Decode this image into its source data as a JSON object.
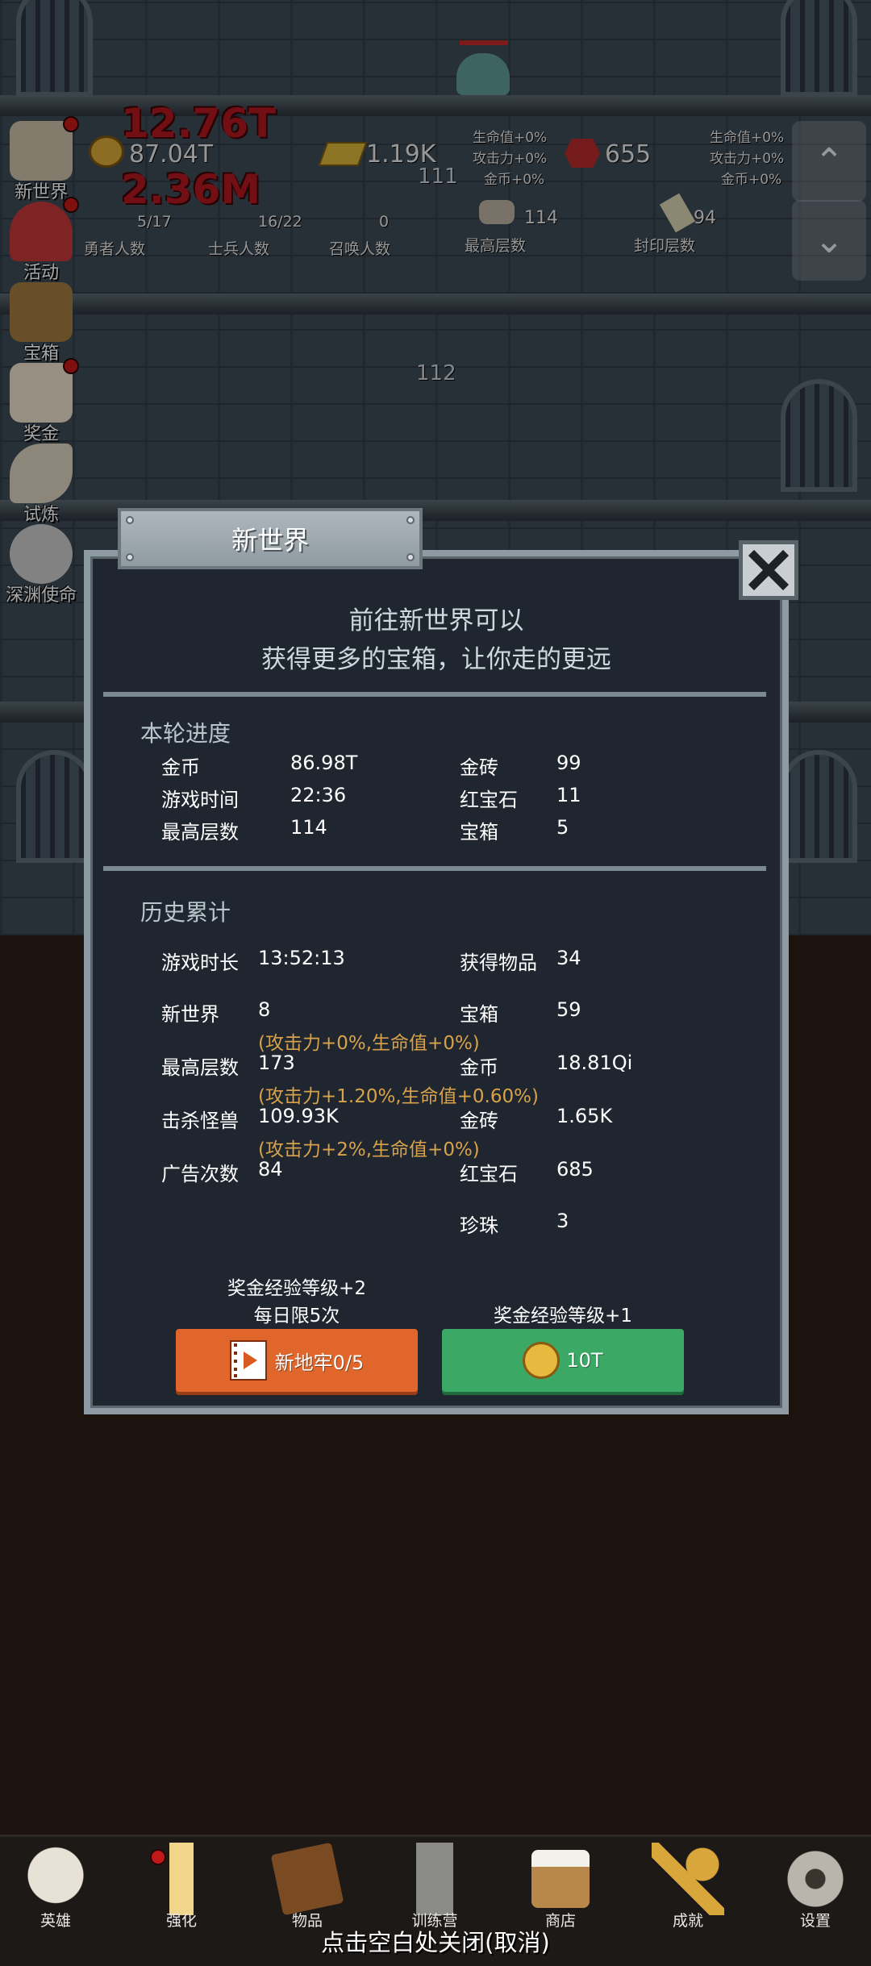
{
  "hud": {
    "gold_value": "87.04T",
    "gold_bar_value": "1.19K",
    "ruby_value": "655",
    "stats_left": [
      "生命值+0%",
      "攻击力+0%",
      "金币+0%"
    ],
    "stats_right": [
      "生命值+0%",
      "攻击力+0%",
      "金币+0%"
    ],
    "hero_count": "5/17",
    "hero_label": "勇者人数",
    "soldier_count": "16/22",
    "soldier_label": "士兵人数",
    "summon_count": "0",
    "summon_label": "召唤人数",
    "max_floor_value": "114",
    "max_floor_label": "最高层数",
    "seal_floor_value": "94",
    "seal_floor_label": "封印层数",
    "damage_1": "12.76T",
    "damage_2": "2.36M",
    "floor_111": "111",
    "floor_112": "112"
  },
  "side_menu": [
    {
      "label": "新世界",
      "badge": true
    },
    {
      "label": "活动",
      "badge": true
    },
    {
      "label": "宝箱",
      "badge": false
    },
    {
      "label": "奖金",
      "badge": true
    },
    {
      "label": "试炼",
      "badge": false
    },
    {
      "label": "深渊使命",
      "badge": false
    }
  ],
  "dialog": {
    "title": "新世界",
    "intro_line1": "前往新世界可以",
    "intro_line2": "获得更多的宝箱，让你走的更远",
    "current_title": "本轮进度",
    "current": {
      "gold_label": "金币",
      "gold_value": "86.98T",
      "brick_label": "金砖",
      "brick_value": "99",
      "time_label": "游戏时间",
      "time_value": "22:36",
      "ruby_label": "红宝石",
      "ruby_value": "11",
      "floor_label": "最高层数",
      "floor_value": "114",
      "chest_label": "宝箱",
      "chest_value": "5"
    },
    "history_title": "历史累计",
    "history": {
      "duration_label": "游戏时长",
      "duration_value": "13:52:13",
      "items_label": "获得物品",
      "items_value": "34",
      "world_label": "新世界",
      "world_value": "8",
      "chest_label": "宝箱",
      "chest_value": "59",
      "world_bonus": "(攻击力+0%,生命值+0%)",
      "floor_label": "最高层数",
      "floor_value": "173",
      "gold_label": "金币",
      "gold_value": "18.81Qi",
      "floor_bonus": "(攻击力+1.20%,生命值+0.60%)",
      "kills_label": "击杀怪兽",
      "kills_value": "109.93K",
      "brick_label": "金砖",
      "brick_value": "1.65K",
      "kills_bonus": "(攻击力+2%,生命值+0%)",
      "ads_label": "广告次数",
      "ads_value": "84",
      "ruby_label": "红宝石",
      "ruby_value": "685",
      "pearl_label": "珍珠",
      "pearl_value": "3"
    },
    "left_note_1": "奖金经验等级+2",
    "left_note_2": "每日限5次",
    "right_note": "奖金经验等级+1",
    "ad_button_label": "新地牢0/5",
    "gold_button_label": "10T"
  },
  "bottom_tabs": [
    {
      "label": "英雄",
      "icon": "skull-icon"
    },
    {
      "label": "强化",
      "icon": "candle-icon"
    },
    {
      "label": "物品",
      "icon": "book-icon"
    },
    {
      "label": "训练营",
      "icon": "lantern-icon"
    },
    {
      "label": "商店",
      "icon": "mug-icon"
    },
    {
      "label": "成就",
      "icon": "key-icon"
    },
    {
      "label": "设置",
      "icon": "gear-icon"
    }
  ],
  "close_hint": "点击空白处关闭(取消)",
  "colors": {
    "panel_bg": "#1f2630",
    "bonus_text": "#d7a24a",
    "orange_button": "#e0662c",
    "green_button": "#3ba866"
  }
}
